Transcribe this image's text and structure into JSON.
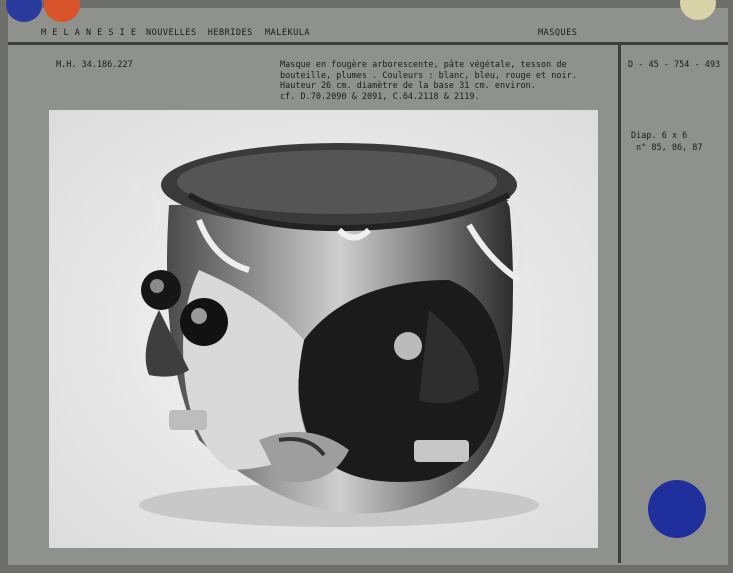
{
  "header": {
    "region": "M E L A N E S I E",
    "archipelago": "NOUVELLES  HEBRIDES",
    "island": "MALEKULA",
    "category": "MASQUES"
  },
  "record": {
    "inventory_number": "M.H. 34.186.227",
    "description_lines": [
      "Masque en fougère arborescente, pâte végétale, tesson de",
      "bouteille, plumes . Couleurs : blanc, bleu, rouge et noir.",
      "Hauteur 26 cm. diamètre de la base 31 cm. environ.",
      "cf. D.70.2090 & 2091, C.64.2118 & 2119."
    ],
    "photo_number": "D - 45 - 754 - 493",
    "slide_format": "Diap. 6 x 6",
    "slide_numbers": "n° 85, 86, 87"
  },
  "colors": {
    "blue_marker": "#1f2f9c",
    "orange_marker": "#d9542a",
    "gold_marker": "#d9d3a8"
  },
  "icons": {
    "photo": "mask-photograph"
  }
}
